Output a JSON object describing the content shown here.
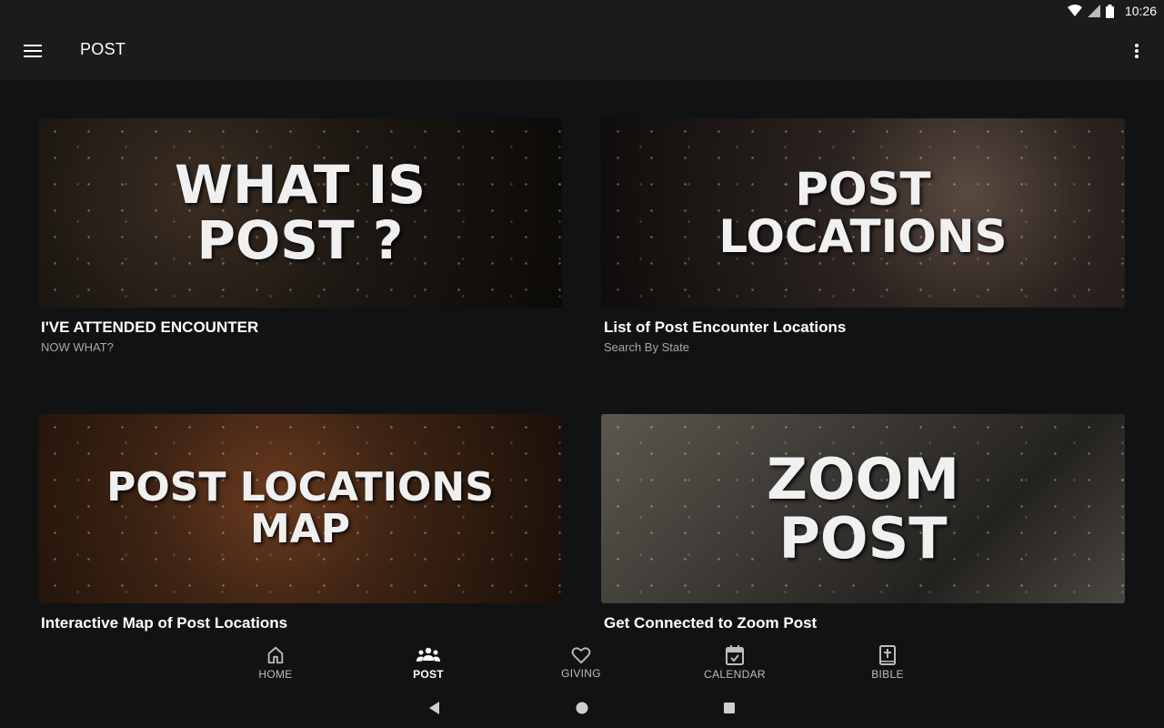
{
  "status_bar": {
    "time": "10:26"
  },
  "app_bar": {
    "title": "POST"
  },
  "cards": [
    {
      "image_text": "WHAT IS\nPOST ?",
      "title": "I'VE ATTENDED ENCOUNTER",
      "subtitle": "NOW WHAT?"
    },
    {
      "image_text": "POST\nLOCATIONS",
      "title": "List of Post Encounter Locations",
      "subtitle": "Search By State"
    },
    {
      "image_text": "POST LOCATIONS\nMAP",
      "title": "Interactive Map of Post Locations",
      "subtitle": ""
    },
    {
      "image_text": "ZOOM\nPOST",
      "title": "Get Connected to Zoom Post",
      "subtitle": ""
    }
  ],
  "bottom_nav": [
    {
      "label": "HOME",
      "icon": "home-icon",
      "active": false
    },
    {
      "label": "POST",
      "icon": "people-icon",
      "active": true
    },
    {
      "label": "GIVING",
      "icon": "heart-icon",
      "active": false
    },
    {
      "label": "CALENDAR",
      "icon": "calendar-icon",
      "active": false
    },
    {
      "label": "BIBLE",
      "icon": "bible-icon",
      "active": false
    }
  ],
  "system_nav": [
    "back-icon",
    "home-circle-icon",
    "recents-icon"
  ]
}
